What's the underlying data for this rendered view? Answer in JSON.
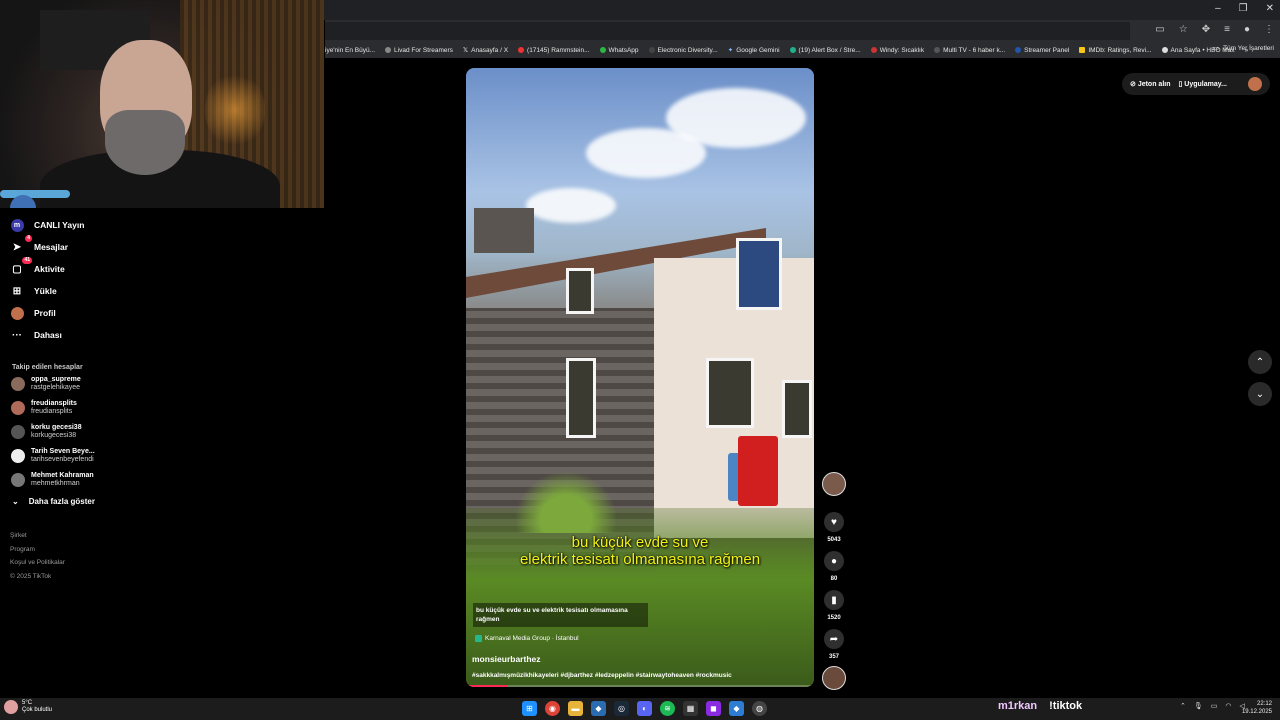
{
  "browser": {
    "window_controls": [
      "–",
      "❐",
      "✕"
    ],
    "bookmarks": [
      {
        "label": "iye'nin En Büyü...",
        "icon": "page-icon"
      },
      {
        "label": "Livad For Streamers",
        "icon": "lv-icon"
      },
      {
        "label": "Anasayfa / X",
        "icon": "x-icon"
      },
      {
        "label": "(17145) Rammstein...",
        "icon": "youtube-icon"
      },
      {
        "label": "WhatsApp",
        "icon": "whatsapp-icon"
      },
      {
        "label": "Electronic Diversity...",
        "icon": "page-icon"
      },
      {
        "label": "Google Gemini",
        "icon": "gemini-icon"
      },
      {
        "label": "(19) Alert Box / Stre...",
        "icon": "alert-icon"
      },
      {
        "label": "Windy: Sıcaklık",
        "icon": "windy-icon"
      },
      {
        "label": "Multi TV - 6 haber k...",
        "icon": "tv-icon"
      },
      {
        "label": "Streamer Panel",
        "icon": "panel-icon"
      },
      {
        "label": "IMDb: Ratings, Revi...",
        "icon": "imdb-icon"
      },
      {
        "label": "Ana Sayfa • HBO Max",
        "icon": "hbo-icon"
      }
    ],
    "bookmarks_more": "»",
    "all_bookmarks": "Tüm Yer İşaretleri"
  },
  "sidebar": {
    "nav": [
      {
        "label": "CANLI Yayın",
        "icon": "live-icon",
        "badge": ""
      },
      {
        "label": "Mesajlar",
        "icon": "send-icon",
        "badge": "4"
      },
      {
        "label": "Aktivite",
        "icon": "inbox-icon",
        "badge": "41"
      },
      {
        "label": "Yükle",
        "icon": "upload-icon",
        "badge": ""
      },
      {
        "label": "Profil",
        "icon": "profile-avatar",
        "badge": ""
      },
      {
        "label": "Dahası",
        "icon": "more-icon",
        "badge": ""
      }
    ],
    "following_title": "Takip edilen hesaplar",
    "accounts": [
      {
        "name": "oppa_supreme",
        "handle": "rastgelehikayee"
      },
      {
        "name": "freudiansplits",
        "handle": "freudiansplits"
      },
      {
        "name": "korku gecesi38",
        "handle": "korkugecesi38"
      },
      {
        "name": "Tarih Seven Beye...",
        "handle": "tarihsevenbeyefendi"
      },
      {
        "name": "Mehmet Kahraman",
        "handle": "mehmetkhrman"
      }
    ],
    "show_more": "Daha fazla göster",
    "footer": [
      "Şirket",
      "Program",
      "Koşul ve Politikalar",
      "© 2025 TikTok"
    ]
  },
  "video": {
    "subtitle_line1": "bu küçük evde su ve",
    "subtitle_line2": "elektrik tesisatı olmamasına rağmen",
    "caption": "bu küçük evde su ve elektrik tesisatı olmamasına rağmen",
    "location": "Karnaval Media Group · İstanbul",
    "username": "monsieurbarthez",
    "hashtags": "#sakkkalmışmüzikhikayeleri #djbarthez #ledzeppelin #stairwaytoheaven #rockmusic",
    "progress": 0.12
  },
  "actions": {
    "likes": "5043",
    "comments": "80",
    "saves": "1520",
    "shares": "357"
  },
  "topright": {
    "coins": "Jeton alın",
    "app": "Uygulamay..."
  },
  "taskbar": {
    "weather_temp": "5°C",
    "weather_desc": "Çok bulutlu",
    "overlay_user": "m1rkan",
    "overlay_cmd": "!tiktok",
    "time": "22:12",
    "date": "19.12.2025"
  }
}
